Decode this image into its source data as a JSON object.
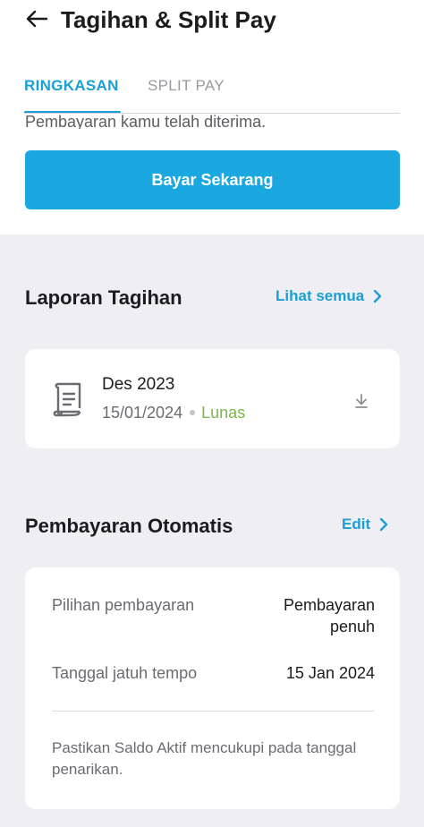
{
  "header": {
    "title": "Tagihan & Split Pay"
  },
  "tabs": [
    {
      "label": "RINGKASAN",
      "active": true
    },
    {
      "label": "SPLIT PAY",
      "active": false
    }
  ],
  "payment_status_text": "Pembayaran kamu telah diterima.",
  "pay_button_label": "Bayar Sekarang",
  "bill_report": {
    "title": "Laporan Tagihan",
    "link_label": "Lihat semua",
    "items": [
      {
        "period": "Des 2023",
        "date": "15/01/2024",
        "status": "Lunas"
      }
    ]
  },
  "auto_payment": {
    "title": "Pembayaran Otomatis",
    "link_label": "Edit",
    "rows": [
      {
        "label": "Pilihan pembayaran",
        "value": "Pembayaran penuh"
      },
      {
        "label": "Tanggal jatuh tempo",
        "value": "15 Jan 2024"
      }
    ],
    "note": "Pastikan Saldo Aktif mencukupi pada tanggal penarikan."
  },
  "colors": {
    "accent": "#1ba7e0",
    "accent_text": "#1a9fd6",
    "status_paid": "#79b74a",
    "background_gray": "#eeeef3"
  },
  "icons": {
    "back": "arrow-left-icon",
    "link_chevron": "chevron-right-icon",
    "document": "document-icon",
    "download": "download-icon"
  }
}
